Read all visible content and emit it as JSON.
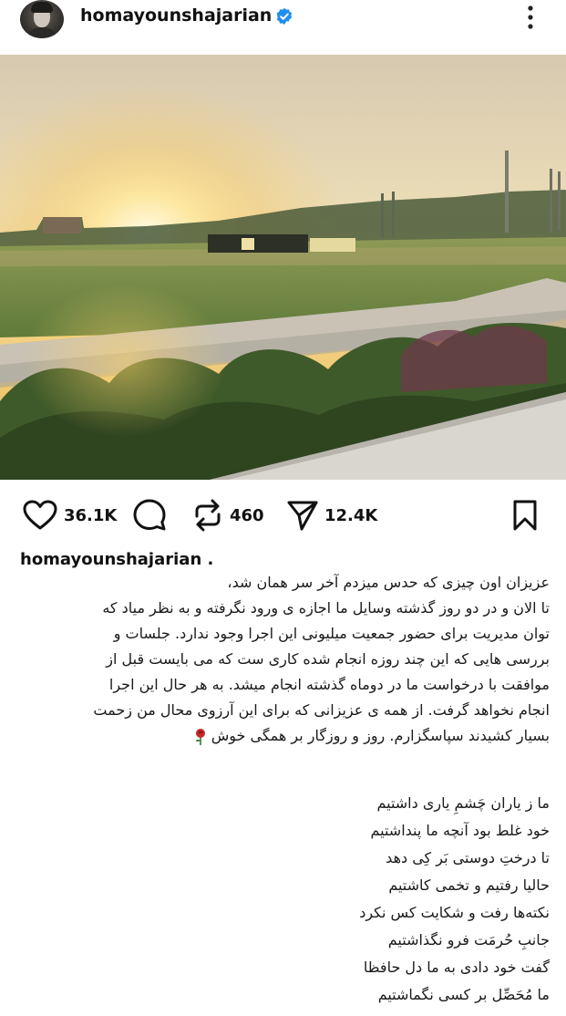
{
  "post": {
    "username": "homayounshajarian",
    "verified": true,
    "accent_color": "#1f8ef1",
    "photo": {
      "description_icon": "sunset-landscape-photo"
    },
    "actions": {
      "likes": "36.1K",
      "reposts": "460",
      "shares": "12.4K"
    },
    "caption_author": "homayounshajarian .",
    "caption_lines": [
      "عزیزان اون چیزی که حدس میزدم آخر سر همان شد،",
      "تا الان و در دو روز گذشته وسایل ما اجازه ی ورود نگرفته و به نظر میاد که",
      "توان مدیریت برای حضور جمعیت میلیونی این اجرا وجود ندارد. جلسات و",
      "بررسی هایی که این چند روزه انجام شده کاری ست که می بایست قبل از",
      "موافقت با درخواست ما در دوماه گذشته انجام میشد. به هر حال این اجرا",
      "انجام نخواهد گرفت. از همه ی عزیزانی که برای این آرزوی محال من زحمت",
      "بسیار کشیدند سپاسگزارم. روز و روزگار بر همگی خوش"
    ],
    "poem_lines": [
      "ما ز یاران چَشمِ یاری داشتیم",
      "خود غلط بود آنچه ما پنداشتیم",
      "تا درختِ دوستی بَر کِی دهد",
      "حالیا رفتیم و تخمی کاشتیم",
      "نکته‌ها رفت و شکایت کس نکرد",
      "جانبِ حُرمَت فرو نگذاشتیم",
      "گفت خود دادی به ما دل حافظا",
      "ما مُحَصِّل بر کسی نگماشتیم"
    ]
  }
}
